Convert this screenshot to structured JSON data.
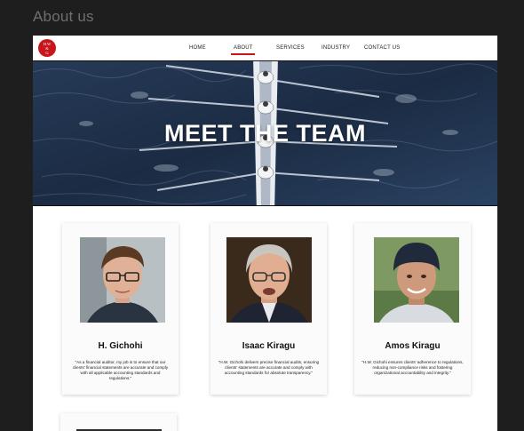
{
  "frame": {
    "title": "About us"
  },
  "logo": {
    "line1": "H.W",
    "line2": "&",
    "line3": "G"
  },
  "nav": {
    "items": [
      {
        "label": "HOME"
      },
      {
        "label": "ABOUT"
      },
      {
        "label": "SERVICES"
      },
      {
        "label": "INDUSTRY"
      },
      {
        "label": "CONTACT US"
      }
    ],
    "active": "ABOUT",
    "accent_color": "#c8161d"
  },
  "hero": {
    "title": "MEET THE TEAM"
  },
  "team": [
    {
      "name": "H. Gichohi",
      "quote": "\"As a financial auditor, my job is to ensure that our clients' financial statements are accurate and comply with all applicable accounting standards and regulations.\""
    },
    {
      "name": "Isaac Kiragu",
      "quote": "\"H.W. Gichohi delivers precise financial audits, ensuring clients' statements are accurate and comply with accounting standards for absolute transparency.\""
    },
    {
      "name": "Amos Kiragu",
      "quote": "\"H.W. Gichohi ensures clients' adherence to regulations, reducing non-compliance risks and fostering organizational accountability and integrity.\""
    }
  ]
}
